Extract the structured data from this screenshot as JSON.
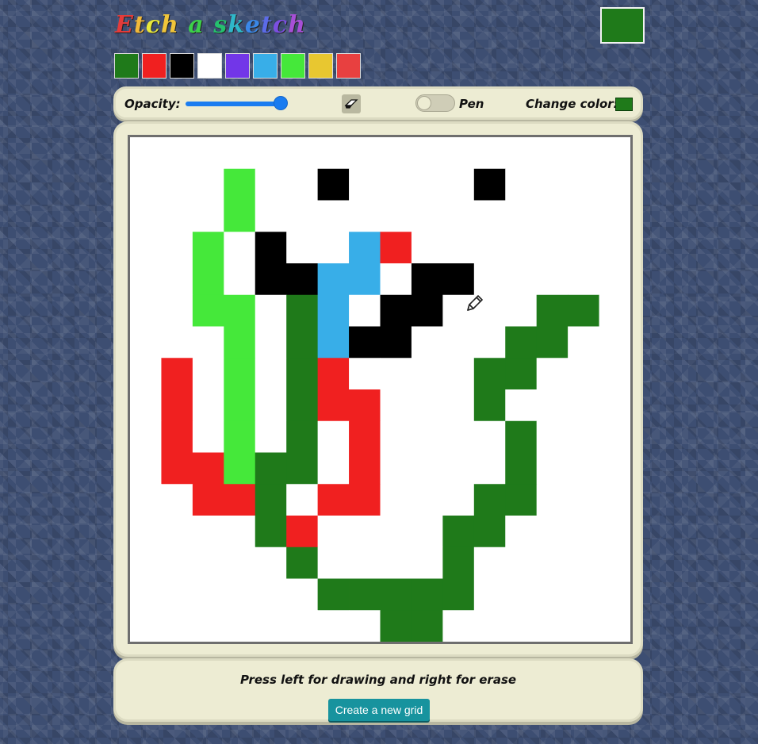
{
  "app": {
    "title_letters": [
      {
        "ch": "E",
        "color": "#e33b3b"
      },
      {
        "ch": "t",
        "color": "#f0b83a"
      },
      {
        "ch": "c",
        "color": "#e8e83a"
      },
      {
        "ch": "h",
        "color": "#f0c53a"
      },
      {
        "ch": " ",
        "color": "#ffffff"
      },
      {
        "ch": "a",
        "color": "#3ccf4a"
      },
      {
        "ch": " ",
        "color": "#ffffff"
      },
      {
        "ch": "s",
        "color": "#25c06e"
      },
      {
        "ch": "k",
        "color": "#2fb7c9"
      },
      {
        "ch": "e",
        "color": "#3a88e8"
      },
      {
        "ch": "t",
        "color": "#5b6be8"
      },
      {
        "ch": "c",
        "color": "#7b4fe0"
      },
      {
        "ch": "h",
        "color": "#a64fd6"
      }
    ],
    "current_color": "#1f7a1a"
  },
  "palette": [
    "#1f7a1a",
    "#f02020",
    "#000000",
    "#ffffff",
    "#7236e8",
    "#38aee8",
    "#45e83a",
    "#e8c730",
    "#e84040"
  ],
  "toolbar": {
    "opacity_label": "Opacity:",
    "opacity_value": 1.0,
    "eraser_icon": "eraser-icon",
    "pen_label": "Pen",
    "change_color_label": "Change color:",
    "change_color_value": "#1f7a1a"
  },
  "grid": {
    "rows": 16,
    "cols": 16,
    "legend": {
      ".": "#ffffff",
      "G": "#45e83a",
      "K": "#000000",
      "B": "#38aee8",
      "R": "#f02020",
      "D": "#1f7a1a"
    },
    "rows_data": [
      "................",
      "...G..K....K....",
      "...G............",
      "..G.K..BR.......",
      "..G.KKBB.KK.....",
      "..GG.DB.KK...DD.",
      "...G.DBKK...DD..",
      ".R.G.DR....DD...",
      ".R.G.DRR...D....",
      ".R.G.D.R....D...",
      ".RRGDD.R....D...",
      "..RRD.RR...DD...",
      "....DR....DD....",
      ".....D....D.....",
      "......DDDDD.....",
      "........DD......"
    ]
  },
  "footer": {
    "instruction": "Press left for drawing and right for erase",
    "new_grid_label": "Create a new grid"
  }
}
